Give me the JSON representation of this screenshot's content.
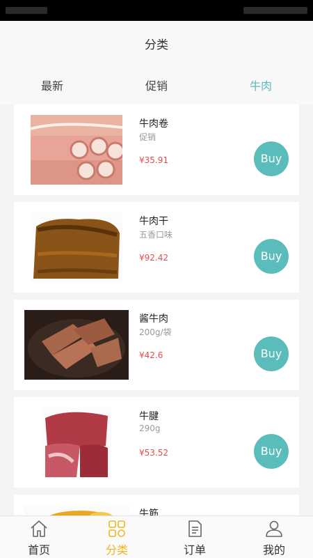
{
  "header": {
    "title": "分类"
  },
  "tabs": [
    {
      "label": "最新"
    },
    {
      "label": "促销"
    },
    {
      "label": "牛肉"
    }
  ],
  "active_tab": "牛肉",
  "products": [
    {
      "name": "牛肉卷",
      "desc": "促销",
      "price": "¥35.91",
      "buy_label": "Buy"
    },
    {
      "name": "牛肉干",
      "desc": "五香口味",
      "price": "¥92.42",
      "buy_label": "Buy"
    },
    {
      "name": "酱牛肉",
      "desc": "200g/袋",
      "price": "¥42.6",
      "buy_label": "Buy"
    },
    {
      "name": "牛腱",
      "desc": "290g",
      "price": "¥53.52",
      "buy_label": "Buy"
    },
    {
      "name": "牛筋"
    }
  ],
  "bottom_nav": [
    {
      "label": "首页",
      "icon": "home-icon"
    },
    {
      "label": "分类",
      "icon": "category-icon"
    },
    {
      "label": "订单",
      "icon": "order-icon"
    },
    {
      "label": "我的",
      "icon": "profile-icon"
    }
  ],
  "active_nav": "分类",
  "colors": {
    "accent": "#5bbcbc",
    "price": "#e54b4b",
    "nav_active": "#f2b51e"
  }
}
